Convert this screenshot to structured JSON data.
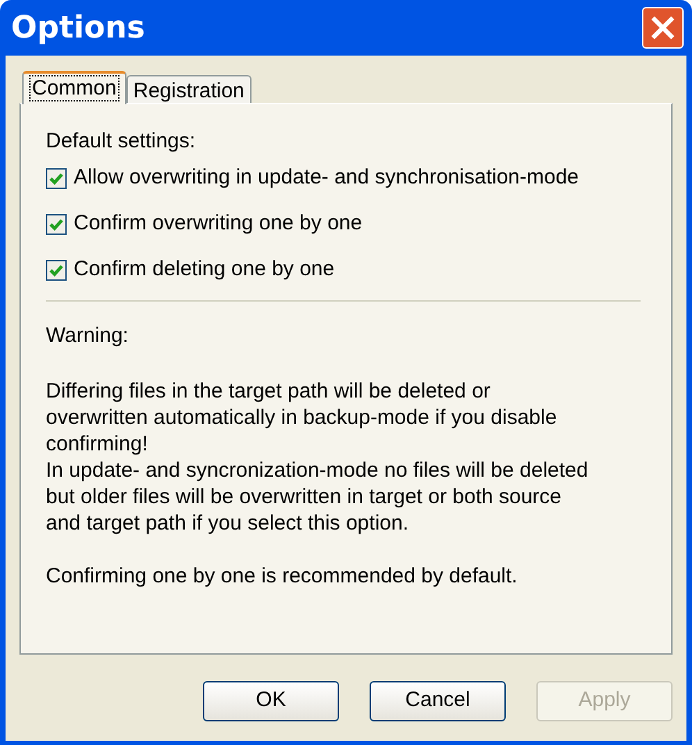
{
  "window": {
    "title": "Options"
  },
  "tabs": [
    {
      "label": "Common",
      "selected": true
    },
    {
      "label": "Registration",
      "selected": false
    }
  ],
  "default_settings": {
    "heading": "Default settings:",
    "options": [
      {
        "label": "Allow overwriting in update- and synchronisation-mode",
        "checked": true
      },
      {
        "label": "Confirm overwriting one by one",
        "checked": true
      },
      {
        "label": "Confirm deleting one by one",
        "checked": true
      }
    ]
  },
  "warning": {
    "heading": "Warning:",
    "paragraphs": [
      "Differing files in the target path will be deleted or overwritten automatically in backup-mode if you disable confirming!",
      "In update- and syncronization-mode no files will be deleted but older files will be overwritten in target or both source and target path if you select this option."
    ],
    "note": "Confirming one by one is recommended by default."
  },
  "buttons": [
    {
      "label": "OK",
      "disabled": false
    },
    {
      "label": "Cancel",
      "disabled": false
    },
    {
      "label": "Apply",
      "disabled": true
    }
  ]
}
